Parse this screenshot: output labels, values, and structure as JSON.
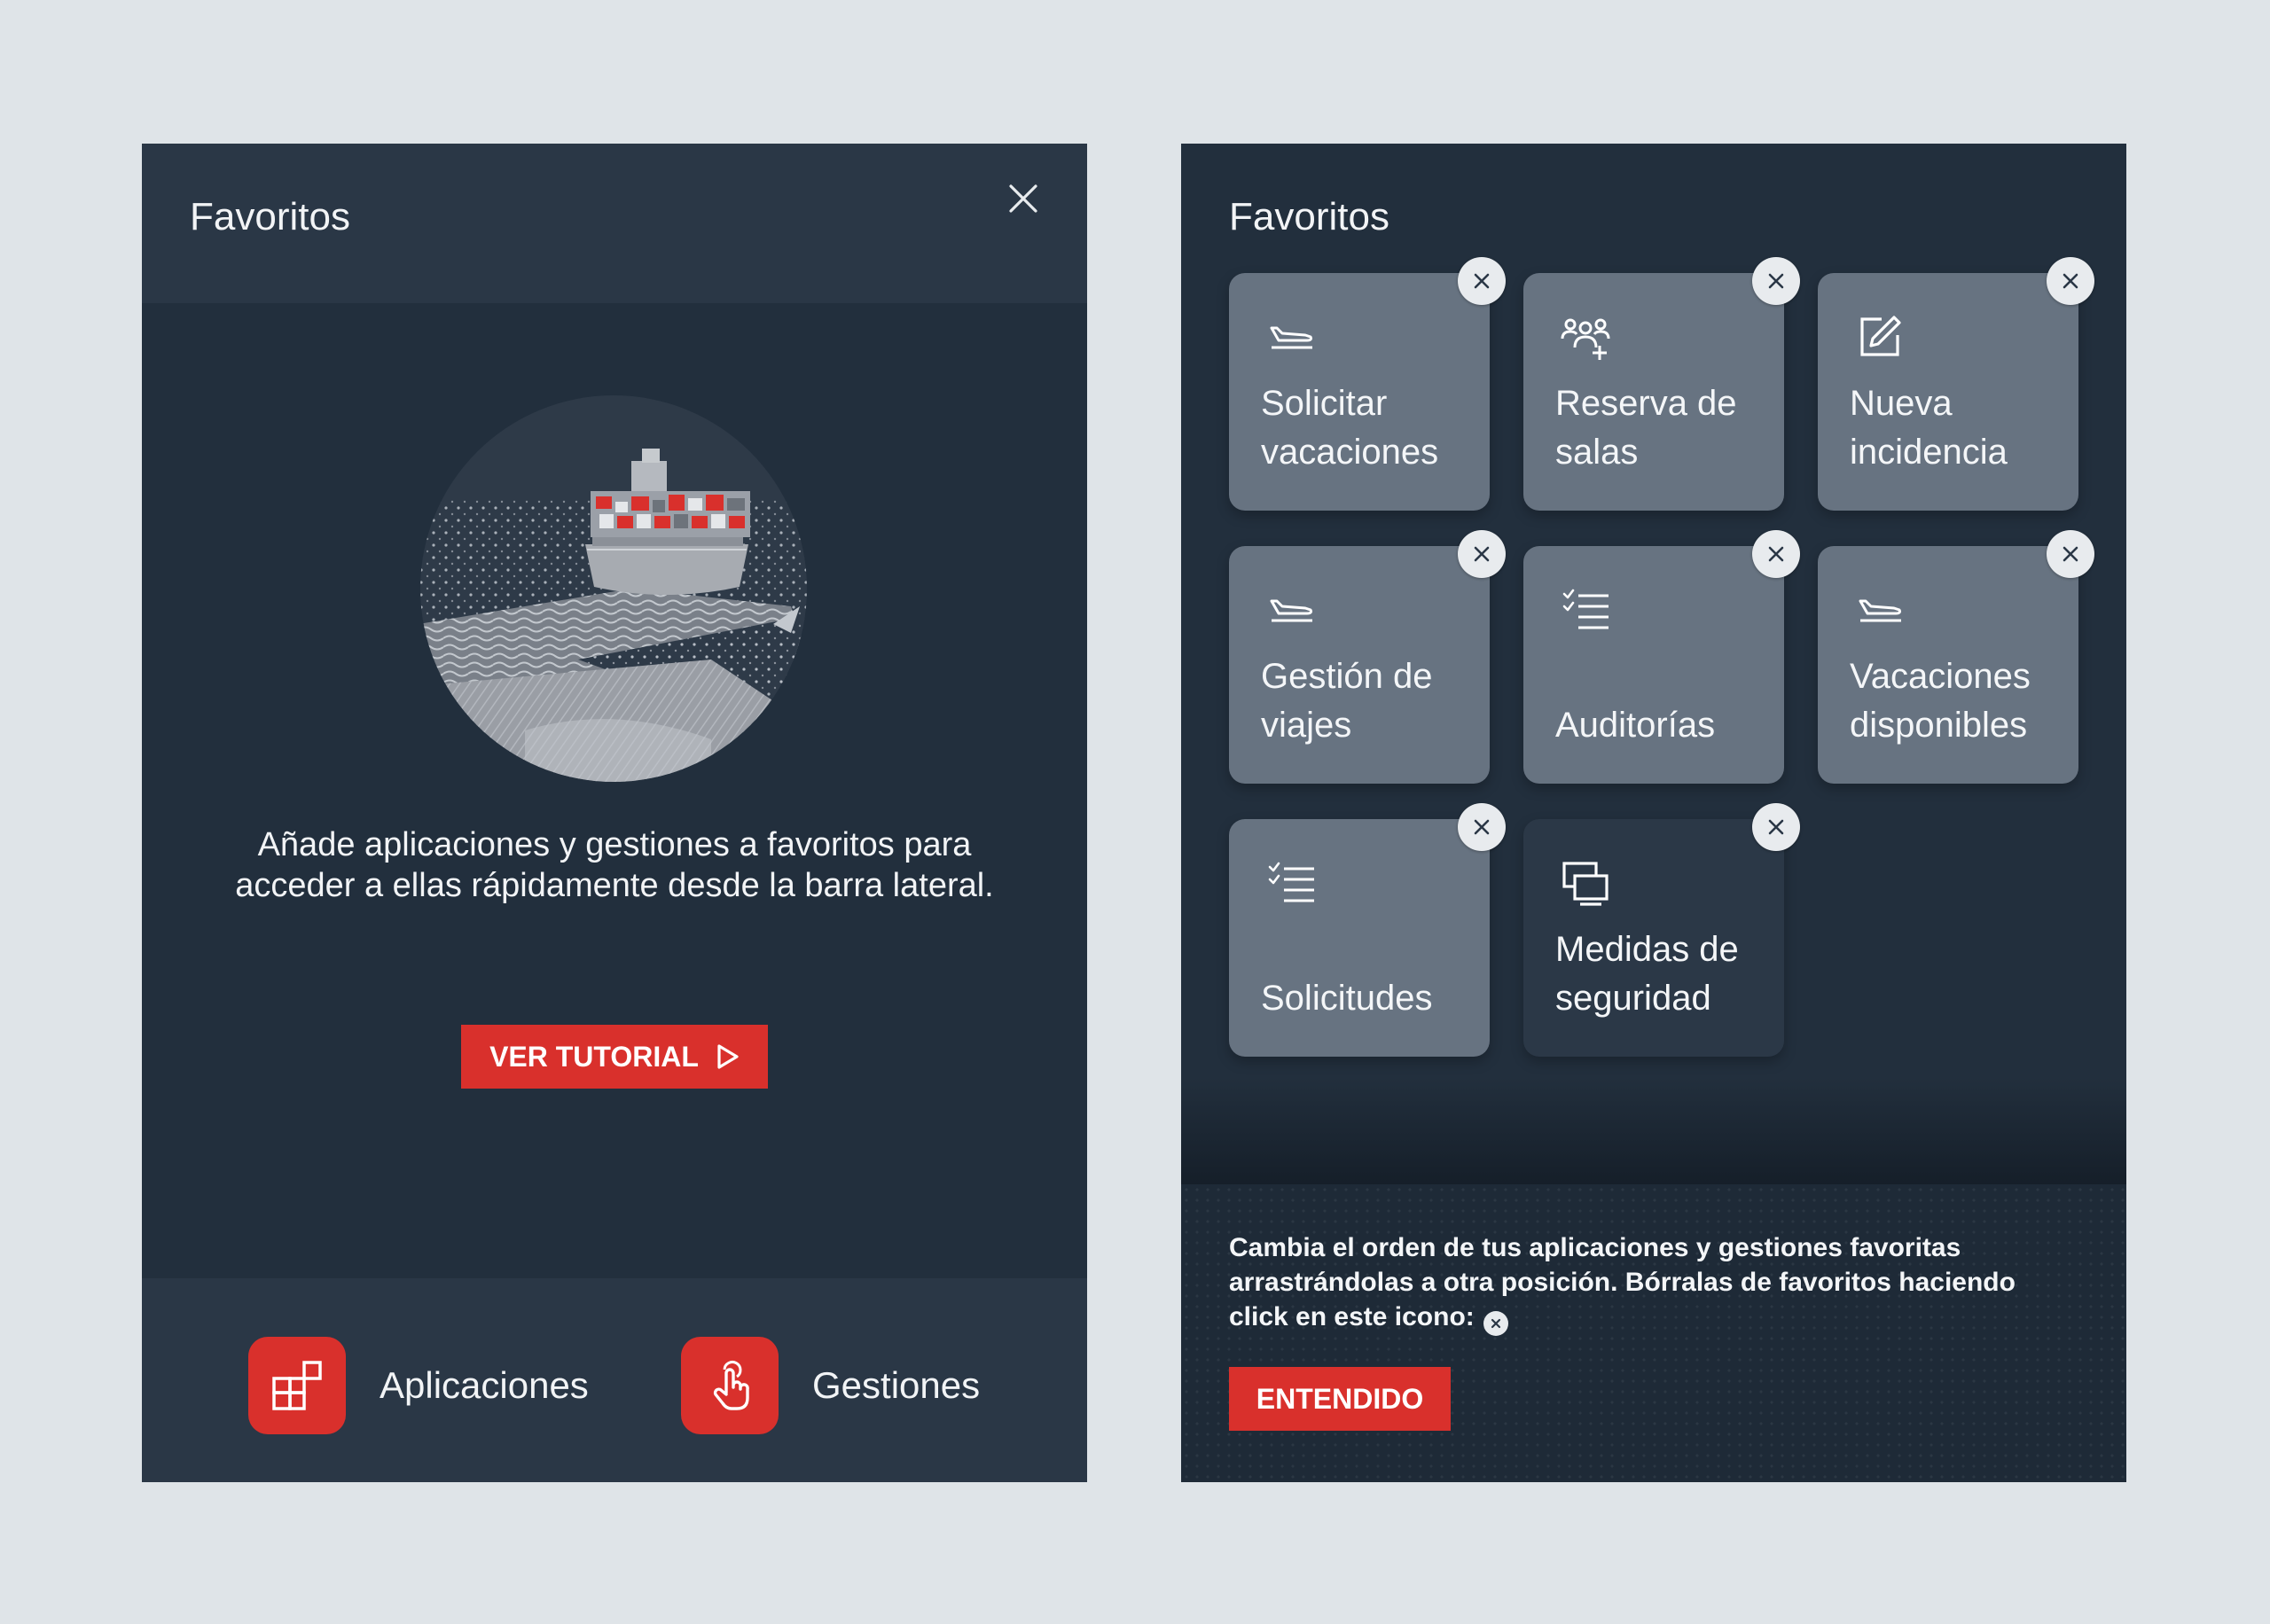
{
  "empty_panel": {
    "title": "Favoritos",
    "message": "Añade aplicaciones y gestiones a favoritos para acceder a ellas rápidamente desde la barra lateral.",
    "tutorial_button": "VER TUTORIAL",
    "nav": [
      {
        "label": "Aplicaciones",
        "icon": "apps-grid-icon"
      },
      {
        "label": "Gestiones",
        "icon": "touch-hand-icon"
      }
    ],
    "illustration": "container-ship-illustration"
  },
  "favorites_panel": {
    "title": "Favoritos",
    "tiles": [
      {
        "label": "Solicitar\nvacaciones",
        "icon": "plane-landing-icon"
      },
      {
        "label": "Reserva de\nsalas",
        "icon": "people-add-icon"
      },
      {
        "label": "Nueva\nincidencia",
        "icon": "edit-icon"
      },
      {
        "label": "Gestión de\nviajes",
        "icon": "plane-landing-icon"
      },
      {
        "label": "Auditorías",
        "icon": "checklist-icon"
      },
      {
        "label": "Vacaciones\ndisponibles",
        "icon": "plane-landing-icon"
      },
      {
        "label": "Solicitudes",
        "icon": "checklist-icon"
      },
      {
        "label": "Medidas de\nseguridad",
        "icon": "screens-icon"
      }
    ],
    "tip": "Cambia el orden de tus aplicaciones y gestiones favoritas arrastrándolas a otra posición. Bórralas de favoritos haciendo click en este icono:",
    "ok_button": "ENTENDIDO"
  },
  "colors": {
    "background": "#dfe4e8",
    "panel": "#222f3d",
    "panel_header": "#2a3746",
    "accent": "#d9302c",
    "tile": "#677381",
    "tile_dark": "#2b3847"
  }
}
